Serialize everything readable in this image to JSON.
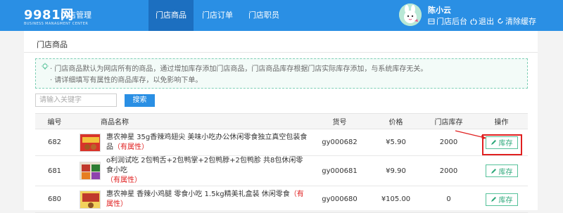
{
  "header": {
    "logo": "9981网",
    "logo_sub": "BUSINESS MANAGMENT CENTER",
    "system_name": "门店管理",
    "nav": [
      {
        "label": "门店商品",
        "active": true
      },
      {
        "label": "门店订单",
        "active": false
      },
      {
        "label": "门店职员",
        "active": false
      }
    ],
    "user_name": "陈小云",
    "links": {
      "backend": "门店后台",
      "logout": "退出",
      "clear_cache": "清除缓存"
    },
    "colors": {
      "bar": "#2a8fe4",
      "active_nav": "#1c6fc0"
    }
  },
  "page": {
    "title": "门店商品",
    "tips": [
      "门店商品默认为网店所有的商品，通过增加库存添加门店商品，门店商品库存根据门店实际库存添加，与系统库存无关。",
      "请详细填写有属性的商品库存，以免影响下单。"
    ],
    "search": {
      "placeholder": "请输入关键字",
      "button": "搜索"
    }
  },
  "table": {
    "columns": [
      "编号",
      "商品名称",
      "货号",
      "价格",
      "门店库存",
      "操作"
    ],
    "rows": [
      {
        "id": "682",
        "name": "惠农神星 35g香辣鸡翅尖 美味小吃办公休闲零食独立真空包装食品",
        "tag": "（有属性）",
        "sku": "gy000682",
        "price": "¥5.90",
        "stock": "2000",
        "action": "库存"
      },
      {
        "id": "681",
        "name": "o利润试吃 2包鸭舌+2包鸭掌+2包鸭脖+2包鸭胗 共8包休闲零食小吃",
        "tag": "（有属性）",
        "sku": "gy000681",
        "price": "¥9.90",
        "stock": "2000",
        "action": "库存"
      },
      {
        "id": "680",
        "name": "惠农神星 香辣小鸡腿 零食小吃 1.5kg精美礼盒装 休闲零食",
        "tag": "（有属性）",
        "sku": "gy000680",
        "price": "¥105.00",
        "stock": "0",
        "action": "库存"
      }
    ]
  }
}
